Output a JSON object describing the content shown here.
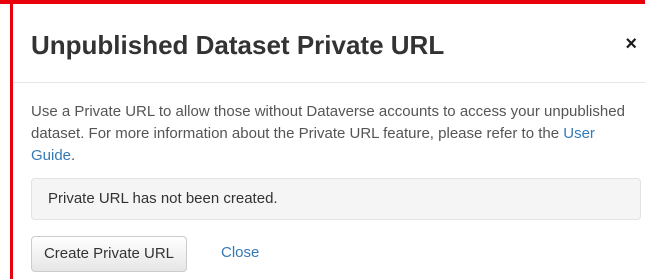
{
  "dialog": {
    "title": "Unpublished Dataset Private URL",
    "close_symbol": "×",
    "body_text": "Use a Private URL to allow those without Dataverse accounts to access your unpublished dataset. For more information about the Private URL feature, please refer to the",
    "guide_link": "User Guide",
    "guide_suffix": ".",
    "status_message": "Private URL has not been created.",
    "create_button": "Create Private URL",
    "close_link": "Close"
  },
  "colors": {
    "highlight_border": "#e8000b",
    "link": "#337ab7",
    "status_bg": "#f5f5f5"
  }
}
